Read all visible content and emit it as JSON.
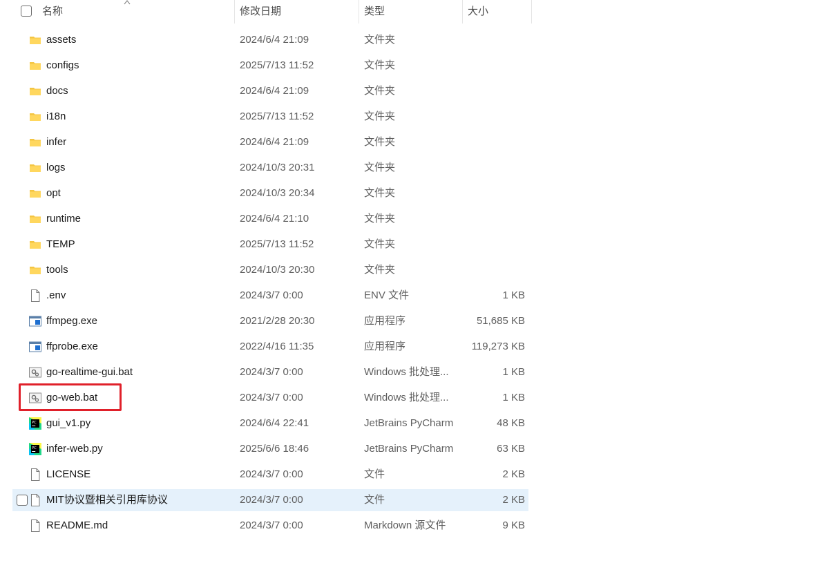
{
  "header": {
    "name": "名称",
    "modified": "修改日期",
    "type": "类型",
    "size": "大小"
  },
  "files": [
    {
      "name": "assets",
      "date": "2024/6/4 21:09",
      "type": "文件夹",
      "size": "",
      "icon": "folder-icon"
    },
    {
      "name": "configs",
      "date": "2025/7/13 11:52",
      "type": "文件夹",
      "size": "",
      "icon": "folder-icon"
    },
    {
      "name": "docs",
      "date": "2024/6/4 21:09",
      "type": "文件夹",
      "size": "",
      "icon": "folder-icon"
    },
    {
      "name": "i18n",
      "date": "2025/7/13 11:52",
      "type": "文件夹",
      "size": "",
      "icon": "folder-icon"
    },
    {
      "name": "infer",
      "date": "2024/6/4 21:09",
      "type": "文件夹",
      "size": "",
      "icon": "folder-icon"
    },
    {
      "name": "logs",
      "date": "2024/10/3 20:31",
      "type": "文件夹",
      "size": "",
      "icon": "folder-icon"
    },
    {
      "name": "opt",
      "date": "2024/10/3 20:34",
      "type": "文件夹",
      "size": "",
      "icon": "folder-icon"
    },
    {
      "name": "runtime",
      "date": "2024/6/4 21:10",
      "type": "文件夹",
      "size": "",
      "icon": "folder-icon"
    },
    {
      "name": "TEMP",
      "date": "2025/7/13 11:52",
      "type": "文件夹",
      "size": "",
      "icon": "folder-icon"
    },
    {
      "name": "tools",
      "date": "2024/10/3 20:30",
      "type": "文件夹",
      "size": "",
      "icon": "folder-icon"
    },
    {
      "name": ".env",
      "date": "2024/3/7 0:00",
      "type": "ENV 文件",
      "size": "1 KB",
      "icon": "file-icon"
    },
    {
      "name": "ffmpeg.exe",
      "date": "2021/2/28 20:30",
      "type": "应用程序",
      "size": "51,685 KB",
      "icon": "exe-icon"
    },
    {
      "name": "ffprobe.exe",
      "date": "2022/4/16 11:35",
      "type": "应用程序",
      "size": "119,273 KB",
      "icon": "exe-icon"
    },
    {
      "name": "go-realtime-gui.bat",
      "date": "2024/3/7 0:00",
      "type": "Windows 批处理...",
      "size": "1 KB",
      "icon": "bat-icon"
    },
    {
      "name": "go-web.bat",
      "date": "2024/3/7 0:00",
      "type": "Windows 批处理...",
      "size": "1 KB",
      "icon": "bat-icon"
    },
    {
      "name": "gui_v1.py",
      "date": "2024/6/4 22:41",
      "type": "JetBrains PyCharm",
      "size": "48 KB",
      "icon": "pycharm-icon"
    },
    {
      "name": "infer-web.py",
      "date": "2025/6/6 18:46",
      "type": "JetBrains PyCharm",
      "size": "63 KB",
      "icon": "pycharm-icon"
    },
    {
      "name": "LICENSE",
      "date": "2024/3/7 0:00",
      "type": "文件",
      "size": "2 KB",
      "icon": "file-icon"
    },
    {
      "name": "MIT协议暨相关引用库协议",
      "date": "2024/3/7 0:00",
      "type": "文件",
      "size": "2 KB",
      "icon": "file-icon",
      "hovered": true
    },
    {
      "name": "README.md",
      "date": "2024/3/7 0:00",
      "type": "Markdown 源文件",
      "size": "9 KB",
      "icon": "file-icon"
    }
  ],
  "colors": {
    "folder": "#f4c542",
    "hover_row": "#e5f1fb",
    "annotation_box": "#e0202a"
  }
}
